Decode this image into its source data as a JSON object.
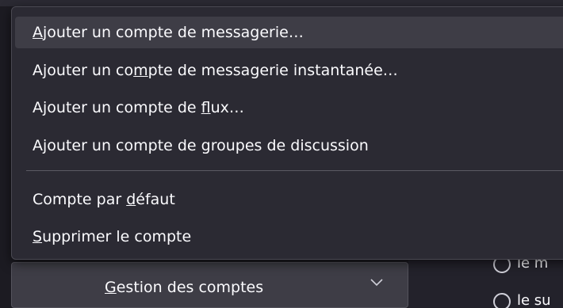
{
  "menu": {
    "items": [
      {
        "before": "",
        "mnemonic": "A",
        "after": "jouter un compte de messagerie…"
      },
      {
        "before": "Ajouter un co",
        "mnemonic": "m",
        "after": "pte de messagerie instantanée…"
      },
      {
        "before": "Ajouter un compte de ",
        "mnemonic": "f",
        "after": "lux…"
      },
      {
        "before": "Ajouter un compte de groupes de discussion",
        "mnemonic": "",
        "after": ""
      },
      {
        "before": "Compte par ",
        "mnemonic": "d",
        "after": "éfaut"
      },
      {
        "before": "",
        "mnemonic": "S",
        "after": "upprimer le compte"
      }
    ]
  },
  "account_button": {
    "before": "",
    "mnemonic": "G",
    "after": "estion des comptes",
    "icon": "chevron-down-icon"
  },
  "background": {
    "radio_1_text": "le m",
    "radio_2_text": "le su"
  },
  "colors": {
    "menu_bg": "#2b2a33",
    "hover_bg": "#3e3d46",
    "text": "#fbfbfe"
  }
}
